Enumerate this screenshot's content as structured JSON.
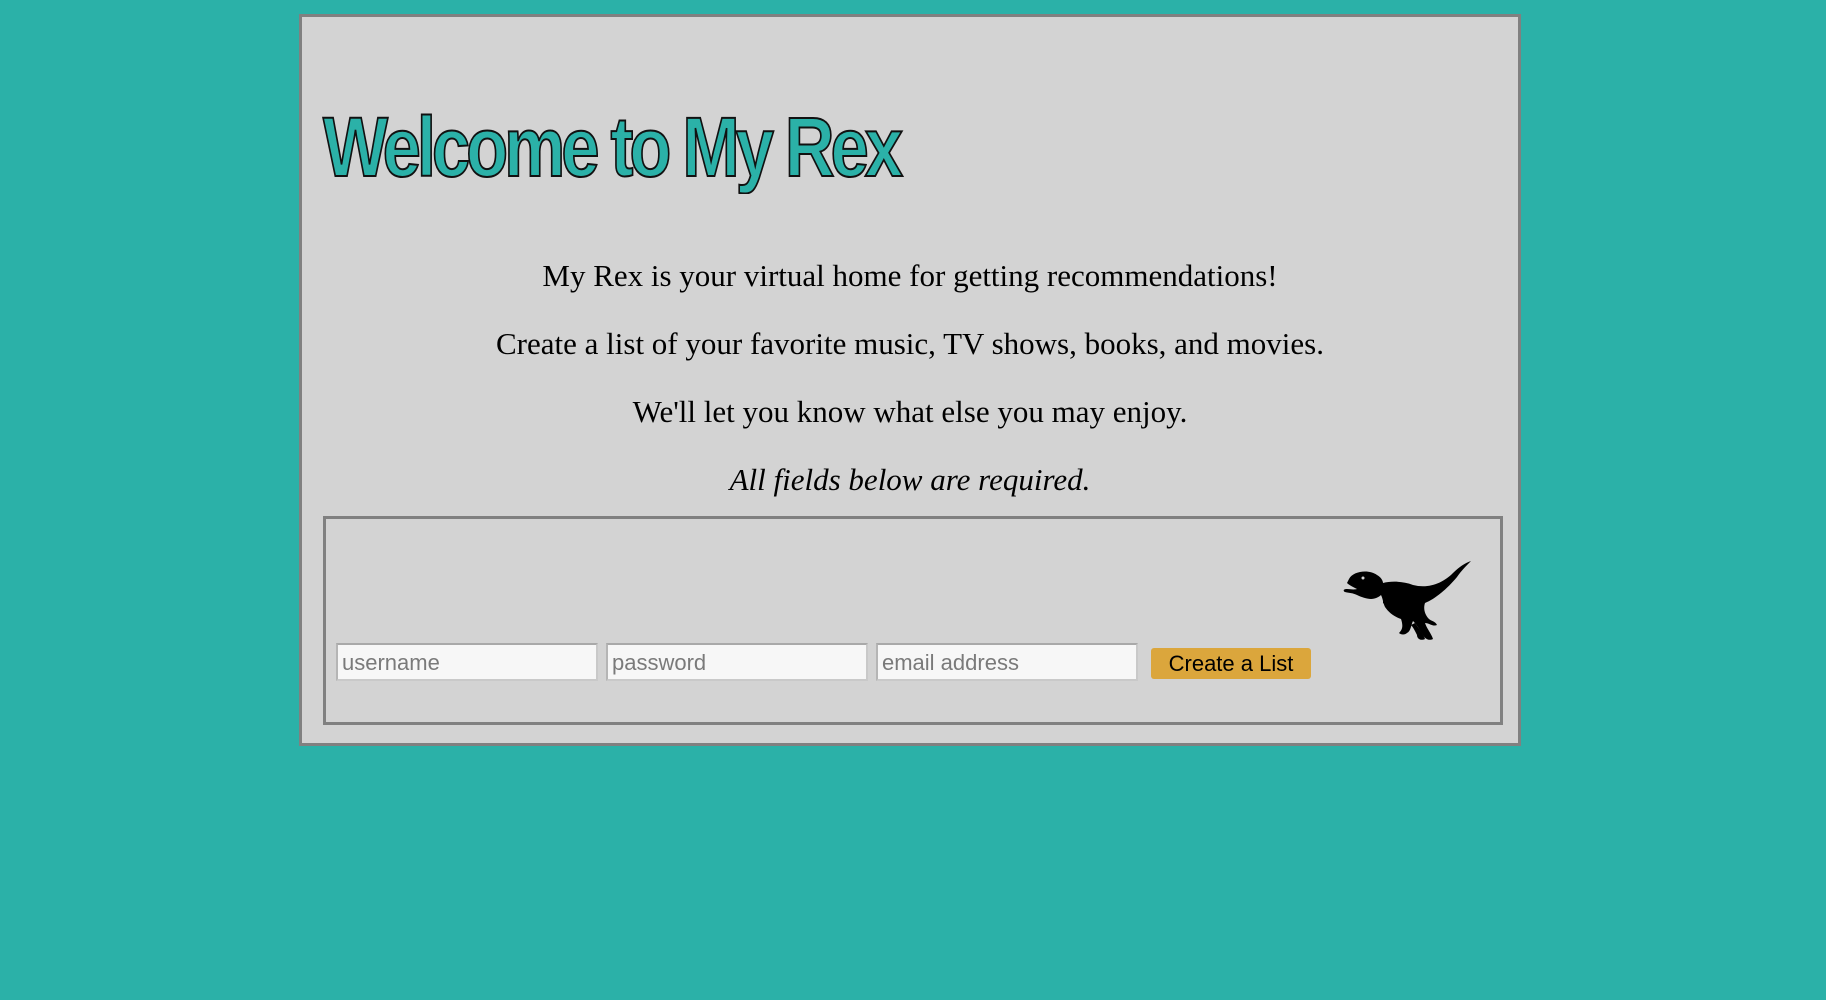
{
  "page": {
    "title": "Welcome to My Rex",
    "intro": [
      "My Rex is your virtual home for getting recommendations!",
      "Create a list of your favorite music, TV shows, books, and movies.",
      "We'll let you know what else you may enjoy.",
      "All fields below are required."
    ]
  },
  "form": {
    "username_placeholder": "username",
    "password_placeholder": "password",
    "email_placeholder": "email address",
    "submit_label": "Create a List",
    "logo_icon": "t-rex-icon"
  },
  "colors": {
    "background": "#2bb1a8",
    "card": "#d3d3d3",
    "border": "#808080",
    "button": "#dba63c",
    "title": "#2bb1a8"
  }
}
